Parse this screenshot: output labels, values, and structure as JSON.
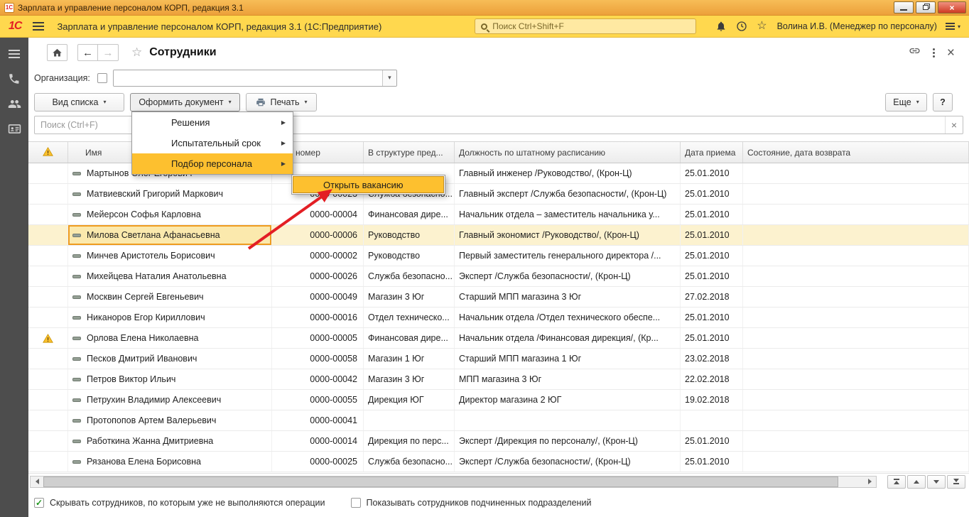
{
  "window": {
    "title": "Зарплата и управление персоналом КОРП, редакция 3.1"
  },
  "appbar": {
    "logo": "1С",
    "title": "Зарплата и управление персоналом КОРП, редакция 3.1  (1С:Предприятие)",
    "search_placeholder": "Поиск Ctrl+Shift+F",
    "user": "Волина И.В. (Менеджер по персоналу)"
  },
  "page": {
    "title": "Сотрудники",
    "org_label": "Организация:"
  },
  "actions": {
    "view_list": "Вид списка",
    "create_document": "Оформить документ",
    "print": "Печать",
    "more": "Еще",
    "help": "?",
    "list_search_placeholder": "Поиск (Ctrl+F)"
  },
  "menu": {
    "items": [
      "Решения",
      "Испытательный срок",
      "Подбор персонала"
    ],
    "highlighted_index": 2,
    "submenu_item": "Открыть вакансию"
  },
  "table": {
    "columns": [
      "Имя",
      "Таб. номер",
      "В структуре пред...",
      "Должность по штатному расписанию",
      "Дата приема",
      "Состояние, дата возврата"
    ],
    "rows": [
      {
        "warning": false,
        "selected": false,
        "name": "Мартынов Олег Егорович",
        "number": "",
        "unit": "",
        "position": "Главный инженер /Руководство/, (Крон-Ц)",
        "hired": "25.01.2010",
        "state": ""
      },
      {
        "warning": false,
        "selected": false,
        "name": "Матвиевский Григорий Маркович",
        "number": "0000-00023",
        "unit": "Служба безопасно...",
        "position": "Главный эксперт /Служба безопасности/, (Крон-Ц)",
        "hired": "25.01.2010",
        "state": ""
      },
      {
        "warning": false,
        "selected": false,
        "name": "Мейерсон Софья Карловна",
        "number": "0000-00004",
        "unit": "Финансовая дире...",
        "position": "Начальник отдела – заместитель начальника у...",
        "hired": "25.01.2010",
        "state": ""
      },
      {
        "warning": false,
        "selected": true,
        "name": "Милова Светлана Афанасьевна",
        "number": "0000-00006",
        "unit": "Руководство",
        "position": "Главный экономист /Руководство/, (Крон-Ц)",
        "hired": "25.01.2010",
        "state": ""
      },
      {
        "warning": false,
        "selected": false,
        "name": "Минчев Аристотель Борисович",
        "number": "0000-00002",
        "unit": "Руководство",
        "position": "Первый заместитель генерального директора /...",
        "hired": "25.01.2010",
        "state": ""
      },
      {
        "warning": false,
        "selected": false,
        "name": "Михейцева Наталия Анатольевна",
        "number": "0000-00026",
        "unit": "Служба безопасно...",
        "position": "Эксперт /Служба безопасности/, (Крон-Ц)",
        "hired": "25.01.2010",
        "state": ""
      },
      {
        "warning": false,
        "selected": false,
        "name": "Москвин Сергей Евгеньевич",
        "number": "0000-00049",
        "unit": "Магазин 3 Юг",
        "position": "Старший МПП магазина 3 Юг",
        "hired": "27.02.2018",
        "state": ""
      },
      {
        "warning": false,
        "selected": false,
        "name": "Никаноров Егор Кириллович",
        "number": "0000-00016",
        "unit": "Отдел техническо...",
        "position": "Начальник отдела /Отдел технического обеспе...",
        "hired": "25.01.2010",
        "state": ""
      },
      {
        "warning": true,
        "selected": false,
        "name": "Орлова Елена Николаевна",
        "number": "0000-00005",
        "unit": "Финансовая дире...",
        "position": "Начальник отдела /Финансовая дирекция/, (Кр...",
        "hired": "25.01.2010",
        "state": ""
      },
      {
        "warning": false,
        "selected": false,
        "name": "Песков Дмитрий Иванович",
        "number": "0000-00058",
        "unit": "Магазин 1 Юг",
        "position": "Старший МПП магазина 1 Юг",
        "hired": "23.02.2018",
        "state": ""
      },
      {
        "warning": false,
        "selected": false,
        "name": "Петров Виктор Ильич",
        "number": "0000-00042",
        "unit": "Магазин 3 Юг",
        "position": "МПП магазина 3 Юг",
        "hired": "22.02.2018",
        "state": ""
      },
      {
        "warning": false,
        "selected": false,
        "name": "Петрухин Владимир Алексеевич",
        "number": "0000-00055",
        "unit": "Дирекция ЮГ",
        "position": "Директор магазина 2 ЮГ",
        "hired": "19.02.2018",
        "state": ""
      },
      {
        "warning": false,
        "selected": false,
        "name": "Протопопов Артем Валерьевич",
        "number": "0000-00041",
        "unit": "",
        "position": "",
        "hired": "",
        "state": ""
      },
      {
        "warning": false,
        "selected": false,
        "name": "Работкина Жанна Дмитриевна",
        "number": "0000-00014",
        "unit": "Дирекция по перс...",
        "position": "Эксперт /Дирекция по персоналу/, (Крон-Ц)",
        "hired": "25.01.2010",
        "state": ""
      },
      {
        "warning": false,
        "selected": false,
        "name": "Рязанова Елена Борисовна",
        "number": "0000-00025",
        "unit": "Служба безопасно...",
        "position": "Эксперт /Служба безопасности/, (Крон-Ц)",
        "hired": "25.01.2010",
        "state": ""
      }
    ]
  },
  "footer": {
    "hide_completed_label": "Скрывать сотрудников, по которым уже не выполняются операции",
    "show_subordinate_label": "Показывать сотрудников подчиненных подразделений"
  },
  "icons": {
    "caret_down": "▾",
    "submenu_arrow": "▶",
    "close": "×",
    "back_arrow": "←",
    "forward_arrow": "→",
    "star": "☆",
    "clear": "×"
  },
  "colors": {
    "titlebar_orange": "#f0a93c",
    "toolbar_yellow": "#ffd84e",
    "menu_highlight": "#fdc02f",
    "selected_row": "#fcf2cf",
    "current_cell_border": "#ef9c1f",
    "annotation_arrow_red": "#e31e24",
    "warning_yellow": "#fbc02d"
  }
}
